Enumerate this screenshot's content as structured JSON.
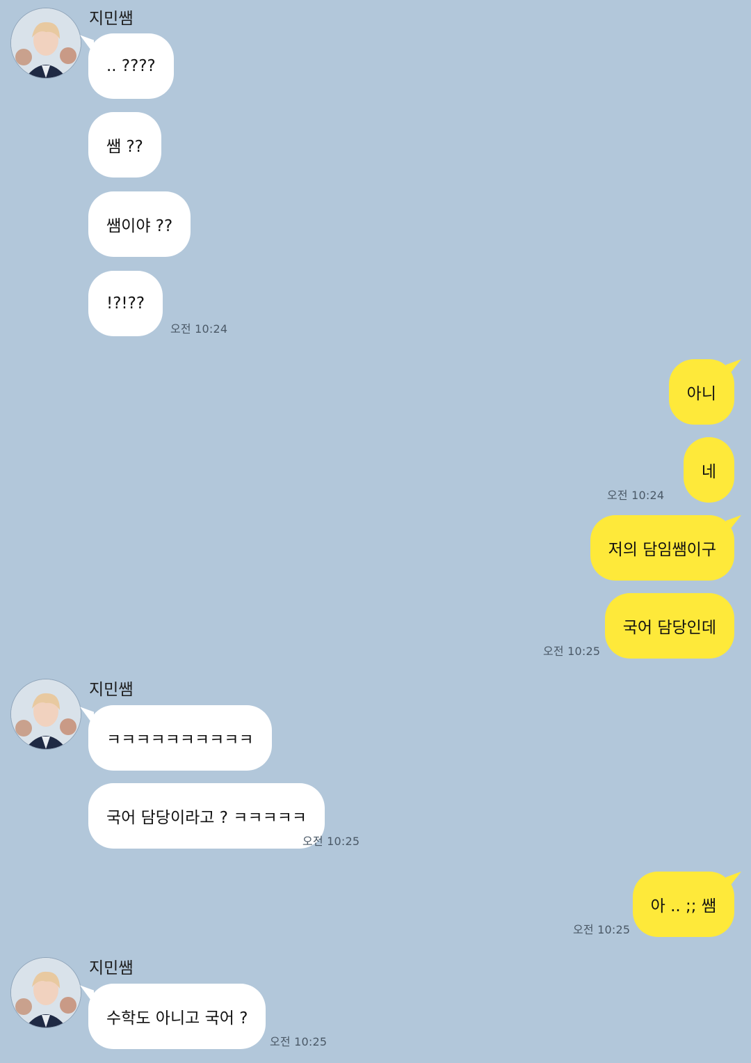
{
  "sender": "지민쌤",
  "groups": [
    {
      "messages": [
        "..  ????",
        "쌤 ??",
        "쌤이야 ??",
        "!?!??"
      ],
      "time": "오전 10:24"
    },
    {
      "messages": [
        "아니",
        "네"
      ],
      "time": "오전 10:24"
    },
    {
      "messages": [
        "저의 담임쌤이구",
        "국어 담당인데"
      ],
      "time": "오전 10:25"
    },
    {
      "messages": [
        "ㅋㅋㅋㅋㅋㅋㅋㅋㅋㅋ",
        "국어 담당이라고 ? ㅋㅋㅋㅋㅋ"
      ],
      "time": "오전 10:25"
    },
    {
      "messages": [
        "아 .. ;; 쌤"
      ],
      "time": "오전 10:25"
    },
    {
      "messages": [
        "수학도 아니고 국어 ?"
      ],
      "time": "오전 10:25"
    }
  ],
  "colors": {
    "background": "#b2c7da",
    "incoming_bubble": "#ffffff",
    "outgoing_bubble": "#fee93a"
  }
}
